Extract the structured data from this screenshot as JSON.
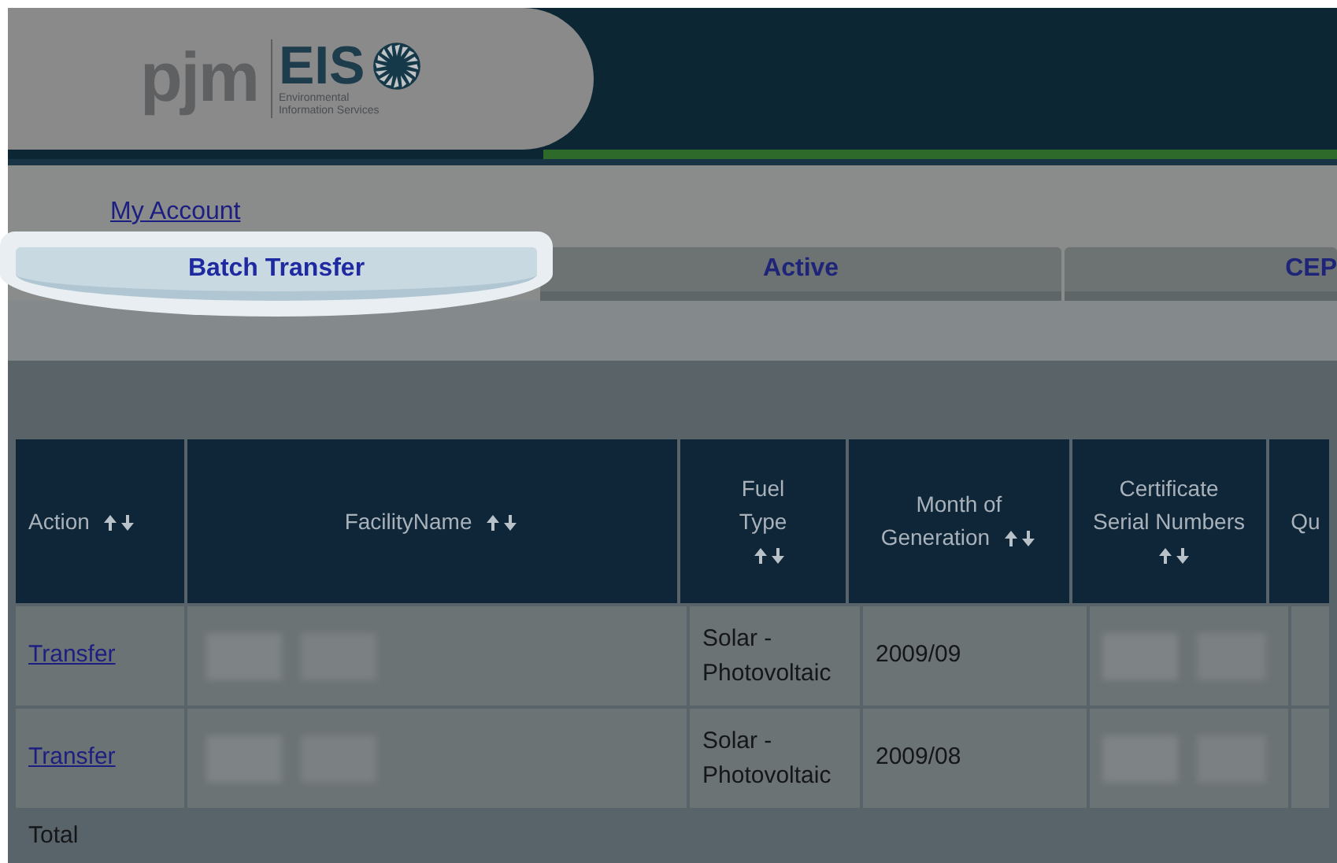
{
  "logo": {
    "brand": "pjm",
    "product": "EIS",
    "subtitle_lines": [
      "Environmental",
      "Information Services"
    ]
  },
  "account_link": "My Account",
  "tabs": [
    {
      "label": "Batch Transfer",
      "selected": true
    },
    {
      "label": "Active",
      "selected": false
    },
    {
      "label": "CEP",
      "selected": false
    }
  ],
  "table": {
    "columns": [
      {
        "label": "Action",
        "sortable": true
      },
      {
        "label": "FacilityName",
        "sortable": true
      },
      {
        "label": "Fuel Type",
        "sortable": true
      },
      {
        "label": "Month of Generation",
        "sortable": true
      },
      {
        "label": "Certificate Serial Numbers",
        "sortable": true
      },
      {
        "label": "Qu",
        "sortable": false
      }
    ],
    "rows": [
      {
        "action": "Transfer",
        "fuel_type": "Solar - Photovoltaic",
        "month": "2009/09"
      },
      {
        "action": "Transfer",
        "fuel_type": "Solar - Photovoltaic",
        "month": "2009/08"
      }
    ],
    "total_label": "Total"
  }
}
